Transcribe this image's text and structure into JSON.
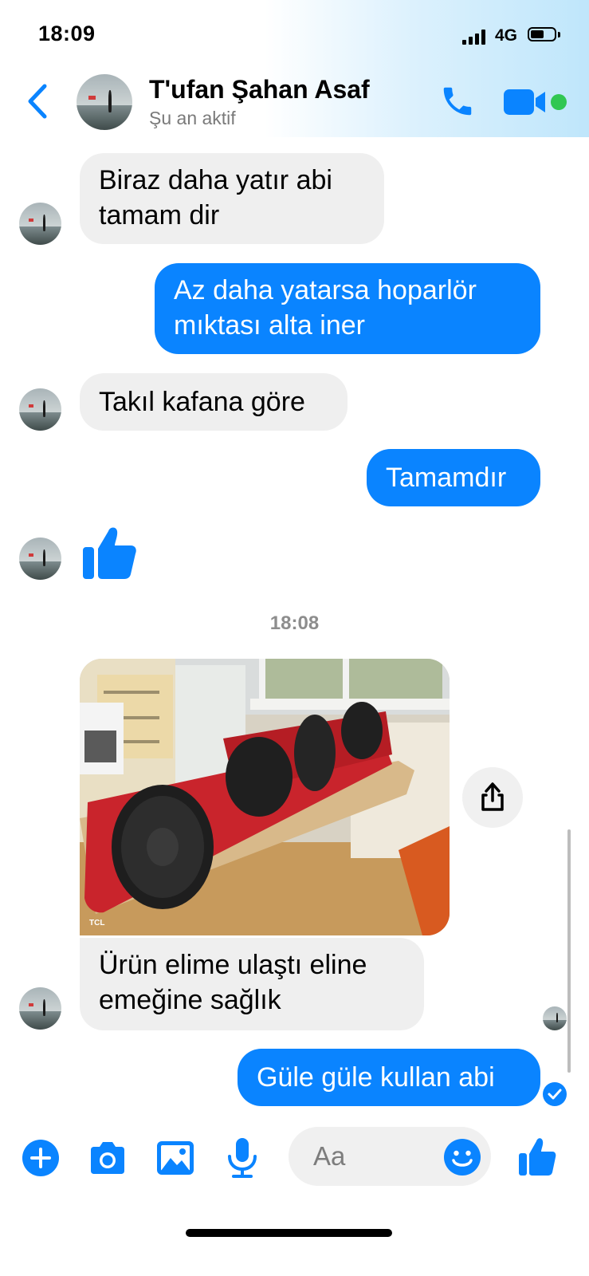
{
  "status_bar": {
    "time": "18:09",
    "network": "4G",
    "battery_level": 0.55
  },
  "header": {
    "contact_name": "T'ufan Şahan Asaf",
    "contact_status": "Şu an aktif",
    "icons": [
      "back-arrow-icon",
      "phone-icon",
      "video-camera-icon"
    ],
    "online_indicator_color": "#31c752"
  },
  "messages": [
    {
      "from": "them",
      "text_line1": "Biraz daha yatır abi",
      "text_line2": "tamam dir"
    },
    {
      "from": "me",
      "text_line1": "Az daha yatarsa hoparlör",
      "text_line2": "mıktası alta iner"
    },
    {
      "from": "them",
      "text": "Takıl kafana göre"
    },
    {
      "from": "me",
      "text": "Tamamdır"
    },
    {
      "from": "them",
      "sticker": "thumbs-up"
    },
    {
      "from": "them",
      "text_line1": "Ürün elime ulaştı eline",
      "text_line2": "emeğine sağlık"
    },
    {
      "from": "me",
      "text": "Güle güle kullan abi"
    }
  ],
  "time_separator": "18:08",
  "photo": {
    "watermark": "TCL"
  },
  "composer": {
    "placeholder": "Aa",
    "icons": [
      "plus-icon",
      "camera-icon",
      "gallery-icon",
      "microphone-icon",
      "emoji-icon",
      "like-icon"
    ]
  },
  "colors": {
    "accent": "#0a84ff",
    "incoming_bubble": "#efefef",
    "outgoing_text": "#ffffff"
  }
}
